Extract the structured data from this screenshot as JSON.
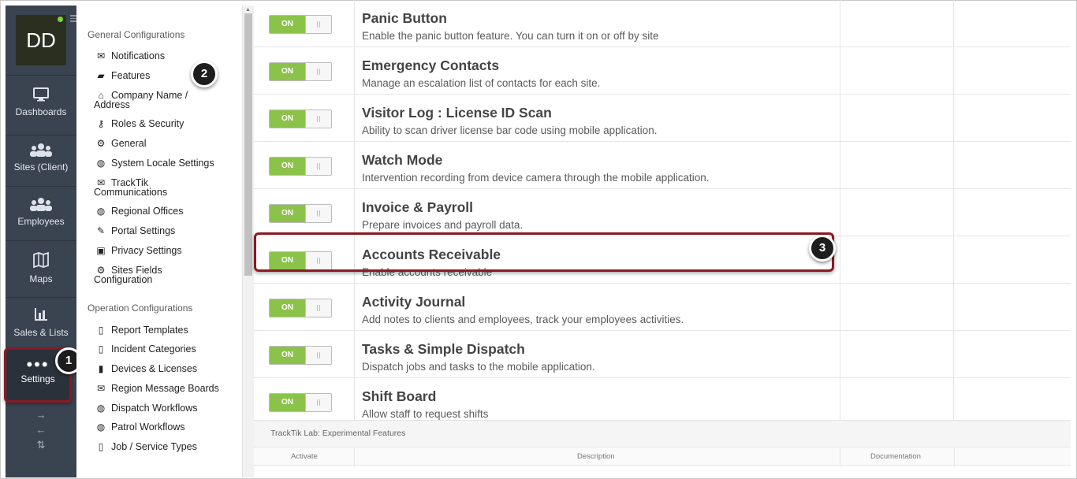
{
  "user": {
    "initials": "DD"
  },
  "rail": {
    "items": [
      {
        "label": "Dashboards",
        "icon": "monitor-icon"
      },
      {
        "label": "Sites (Client)",
        "icon": "group-icon"
      },
      {
        "label": "Employees",
        "icon": "group-icon"
      },
      {
        "label": "Maps",
        "icon": "map-icon"
      },
      {
        "label": "Sales & Lists",
        "icon": "bar-chart-icon"
      }
    ],
    "settings": {
      "label": "Settings",
      "icon": "dots-icon"
    },
    "arrows": [
      "→",
      "←",
      "⇅"
    ]
  },
  "badges": {
    "one": "1",
    "two": "2",
    "three": "3"
  },
  "menu": {
    "general_title": "General Configurations",
    "general": [
      {
        "label": "Notifications",
        "icon": "envelope-icon"
      },
      {
        "label": "Features",
        "icon": "briefcase-icon"
      },
      {
        "label": "Company Name /",
        "label2": "Address",
        "icon": "home-icon"
      },
      {
        "label": "Roles & Security",
        "icon": "key-icon"
      },
      {
        "label": "General",
        "icon": "gear-icon"
      },
      {
        "label": "System Locale Settings",
        "icon": "globe-icon"
      },
      {
        "label": "TrackTik",
        "label2": "Communications",
        "icon": "envelope-icon"
      },
      {
        "label": "Regional Offices",
        "icon": "globe-icon"
      },
      {
        "label": "Portal Settings",
        "icon": "wrench-icon"
      },
      {
        "label": "Privacy Settings",
        "icon": "lock-icon"
      },
      {
        "label": "Sites Fields",
        "label2": "Configuration",
        "icon": "gear-icon"
      }
    ],
    "operation_title": "Operation Configurations",
    "operation": [
      {
        "label": "Report Templates",
        "icon": "file-icon"
      },
      {
        "label": "Incident Categories",
        "icon": "file-icon"
      },
      {
        "label": "Devices & Licenses",
        "icon": "mobile-icon"
      },
      {
        "label": "Region Message Boards",
        "icon": "envelope-icon"
      },
      {
        "label": "Dispatch Workflows",
        "icon": "globe-icon"
      },
      {
        "label": "Patrol Workflows",
        "icon": "globe-icon"
      },
      {
        "label": "Job / Service Types",
        "icon": "file-icon"
      }
    ]
  },
  "features": [
    {
      "title": "Panic Button",
      "desc": "Enable the panic button feature. You can turn it on or off by site",
      "toggle": "ON"
    },
    {
      "title": "Emergency Contacts",
      "desc": "Manage an escalation list of contacts for each site.",
      "toggle": "ON"
    },
    {
      "title": "Visitor Log : License ID Scan",
      "desc": "Ability to scan driver license bar code using mobile application.",
      "toggle": "ON"
    },
    {
      "title": "Watch Mode",
      "desc": "Intervention recording from device camera through the mobile application.",
      "toggle": "ON"
    },
    {
      "title": "Invoice & Payroll",
      "desc": "Prepare invoices and payroll data.",
      "toggle": "ON"
    },
    {
      "title": "Accounts Receivable",
      "desc": "Enable accounts receivable",
      "toggle": "ON"
    },
    {
      "title": "Activity Journal",
      "desc": "Add notes to clients and employees, track your employees activities.",
      "toggle": "ON"
    },
    {
      "title": "Tasks & Simple Dispatch",
      "desc": "Dispatch jobs and tasks to the mobile application.",
      "toggle": "ON"
    },
    {
      "title": "Shift Board",
      "desc": "Allow staff to request shifts",
      "toggle": "ON"
    }
  ],
  "lab": {
    "title": "TrackTik Lab: Experimental Features",
    "columns": [
      "Activate",
      "Description",
      "Documentation"
    ]
  },
  "colors": {
    "toggle_on": "#8bc34a",
    "highlight": "#8a1a22",
    "rail_bg": "#3a4350"
  }
}
